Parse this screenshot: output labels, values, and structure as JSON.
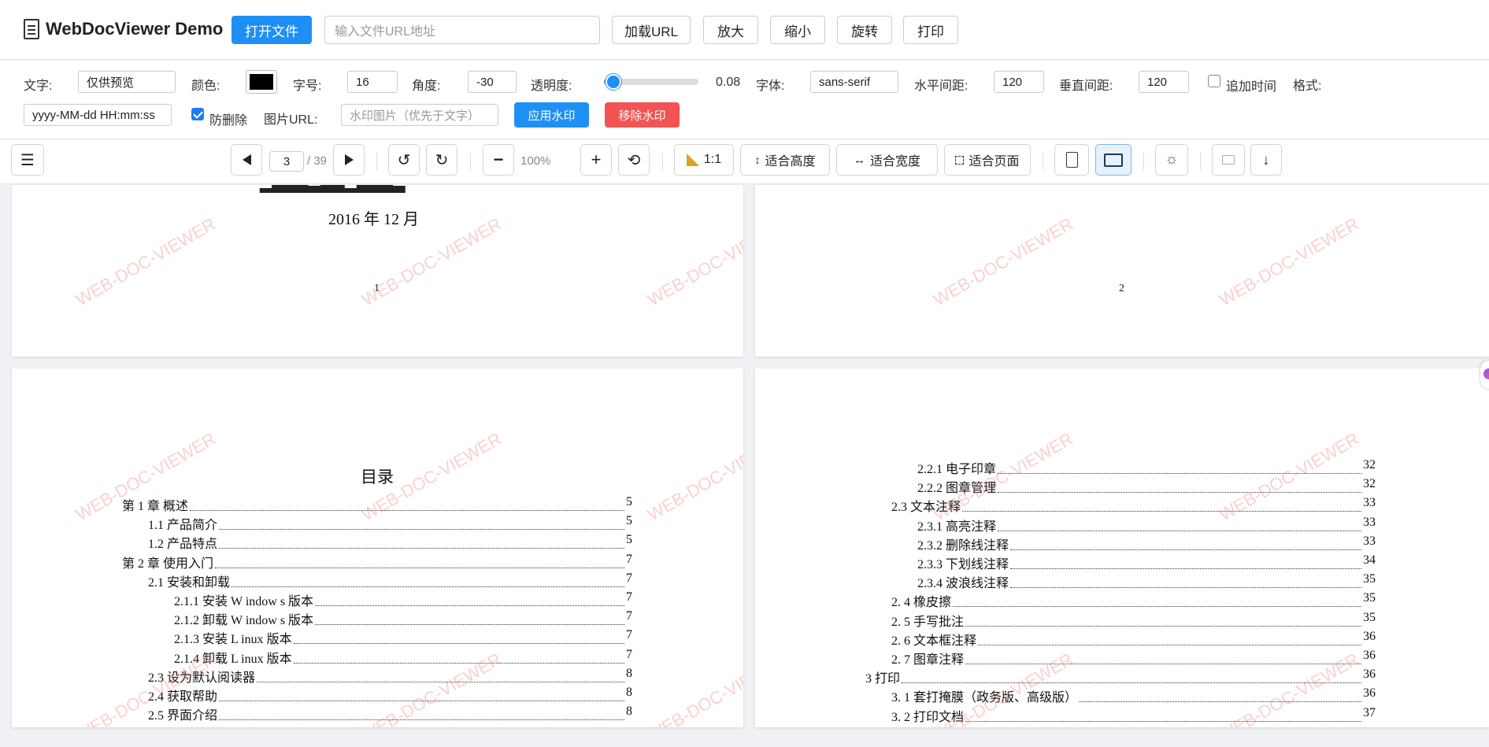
{
  "header": {
    "app_title": "WebDocViewer Demo",
    "open_file": "打开文件",
    "url_placeholder": "输入文件URL地址",
    "load_url": "加载URL",
    "zoom_in": "放大",
    "zoom_out": "缩小",
    "rotate": "旋转",
    "print": "打印"
  },
  "watermark": {
    "text_label": "文字:",
    "text_value": "仅供预览",
    "color_label": "颜色:",
    "color": "#000000",
    "size_label": "字号:",
    "size_value": "16",
    "angle_label": "角度:",
    "angle_value": "-30",
    "opacity_label": "透明度:",
    "opacity_value": "0.08",
    "font_label": "字体:",
    "font_value": "sans-serif",
    "hspace_label": "水平间距:",
    "hspace_value": "120",
    "vspace_label": "垂直间距:",
    "vspace_value": "120",
    "append_time_label": "追加时间",
    "append_time_checked": false,
    "format_label": "格式:",
    "format_value": "yyyy-MM-dd HH:mm:ss",
    "anti_delete_label": "防删除",
    "anti_delete_checked": true,
    "image_url_label": "图片URL:",
    "image_url_placeholder": "水印图片（优先于文字）",
    "apply": "应用水印",
    "remove": "移除水印"
  },
  "toolbar": {
    "menu_icon": "☰",
    "current_page": "3",
    "total_pages": "/ 39",
    "zoom": "100%",
    "actual_size": "1:1",
    "fit_height": "适合高度",
    "fit_width": "适合宽度",
    "fit_page": "适合页面"
  },
  "pages": {
    "page1_date": "2016 年 12 月",
    "page1_num": "1",
    "page2_num": "2",
    "watermark_text": "WEB-DOC-VIEWER",
    "toc_title": "目录",
    "toc_left": [
      {
        "title": "第 1 章   概述",
        "page": "5"
      },
      {
        "title": "1.1 产品简介",
        "page": "5"
      },
      {
        "title": "1.2 产品特点",
        "page": "5"
      },
      {
        "title": "第 2 章   使用入门",
        "page": "7"
      },
      {
        "title": "2.1 安装和卸载",
        "page": "7"
      },
      {
        "title": "2.1.1 安装 W indow s 版本",
        "page": "7"
      },
      {
        "title": "2.1.2 卸载 W indow s 版本",
        "page": "7"
      },
      {
        "title": "2.1.3 安装 L inux 版本",
        "page": "7"
      },
      {
        "title": "2.1.4 卸载 L inux 版本",
        "page": "7"
      },
      {
        "title": "2.3 设为默认阅读器",
        "page": "8"
      },
      {
        "title": "2.4 获取帮助",
        "page": "8"
      },
      {
        "title": "2.5 界面介绍",
        "page": "8"
      }
    ],
    "toc_right": [
      {
        "title": "2.2.1 电子印章",
        "page": "32"
      },
      {
        "title": "2.2.2 图章管理",
        "page": "32"
      },
      {
        "title": "2.3        文本注释",
        "page": "33"
      },
      {
        "title": "2.3.1 高亮注释",
        "page": "33"
      },
      {
        "title": "2.3.2 删除线注释",
        "page": "33"
      },
      {
        "title": "2.3.3 下划线注释",
        "page": "34"
      },
      {
        "title": "2.3.4 波浪线注释",
        "page": "35"
      },
      {
        "title": "2. 4        橡皮擦",
        "page": "35"
      },
      {
        "title": "2. 5        手写批注",
        "page": "35"
      },
      {
        "title": "2. 6        文本框注释",
        "page": "36"
      },
      {
        "title": "2. 7        图章注释",
        "page": "36"
      },
      {
        "title": "3       打印",
        "page": "36"
      },
      {
        "title": "3. 1        套打掩膜（政务版、高级版）",
        "page": "36"
      },
      {
        "title": "3. 2        打印文档",
        "page": "37"
      }
    ]
  }
}
